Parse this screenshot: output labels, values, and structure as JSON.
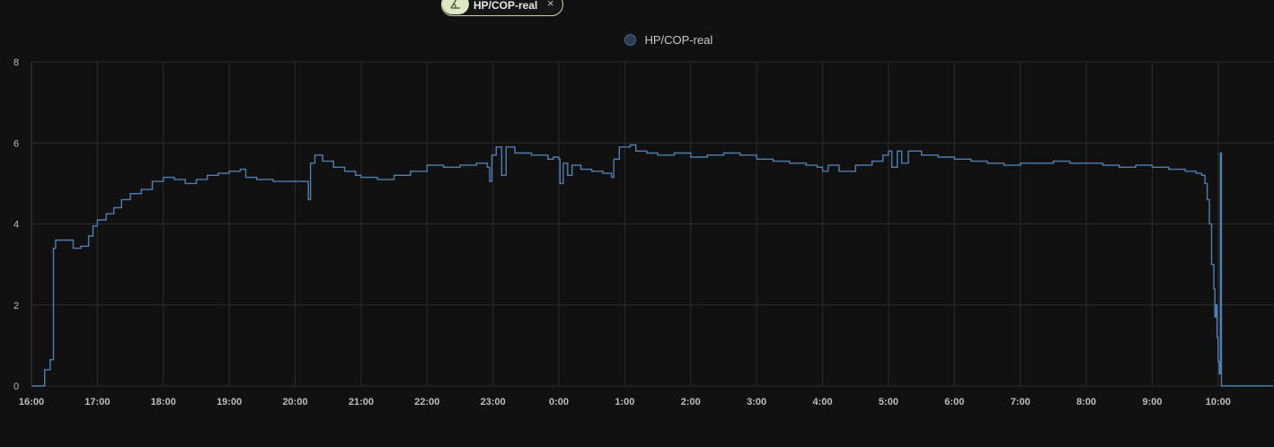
{
  "filter_chip": {
    "label": "HP/COP-real",
    "icon": "sigma-icon",
    "close_glyph": "×"
  },
  "legend": {
    "label": "HP/COP-real",
    "color": "#4a6d93"
  },
  "colors": {
    "background": "#111111",
    "grid": "#2c2c2c",
    "line": "#4f7fb0"
  },
  "chart_data": {
    "type": "line",
    "title": "",
    "xlabel": "",
    "ylabel": "",
    "ylim": [
      0,
      8
    ],
    "yticks": [
      "0",
      "2",
      "4",
      "6",
      "8"
    ],
    "xlim": [
      "16:00",
      "10:50"
    ],
    "xticks": [
      "16:00",
      "17:00",
      "18:00",
      "19:00",
      "20:00",
      "21:00",
      "22:00",
      "23:00",
      "0:00",
      "1:00",
      "2:00",
      "3:00",
      "4:00",
      "5:00",
      "6:00",
      "7:00",
      "8:00",
      "9:00",
      "10:00"
    ],
    "grid": true,
    "legend_position": "top-center",
    "series": [
      {
        "name": "HP/COP-real",
        "step": true,
        "color": "#4f7fb0",
        "points": [
          [
            "16:00",
            0
          ],
          [
            "16:12",
            0
          ],
          [
            "16:12",
            0.4
          ],
          [
            "16:17",
            0.65
          ],
          [
            "16:20",
            3.4
          ],
          [
            "16:22",
            3.6
          ],
          [
            "16:30",
            3.6
          ],
          [
            "16:38",
            3.4
          ],
          [
            "16:45",
            3.45
          ],
          [
            "16:52",
            3.7
          ],
          [
            "16:56",
            3.95
          ],
          [
            "17:00",
            4.1
          ],
          [
            "17:08",
            4.25
          ],
          [
            "17:15",
            4.4
          ],
          [
            "17:22",
            4.6
          ],
          [
            "17:30",
            4.75
          ],
          [
            "17:40",
            4.85
          ],
          [
            "17:50",
            5.05
          ],
          [
            "18:00",
            5.15
          ],
          [
            "18:10",
            5.1
          ],
          [
            "18:20",
            5.0
          ],
          [
            "18:30",
            5.1
          ],
          [
            "18:40",
            5.2
          ],
          [
            "18:50",
            5.25
          ],
          [
            "19:00",
            5.3
          ],
          [
            "19:10",
            5.35
          ],
          [
            "19:15",
            5.15
          ],
          [
            "19:25",
            5.1
          ],
          [
            "19:40",
            5.05
          ],
          [
            "20:00",
            5.05
          ],
          [
            "20:10",
            5.05
          ],
          [
            "20:12",
            4.6
          ],
          [
            "20:14",
            5.5
          ],
          [
            "20:18",
            5.7
          ],
          [
            "20:25",
            5.55
          ],
          [
            "20:35",
            5.4
          ],
          [
            "20:45",
            5.3
          ],
          [
            "20:55",
            5.2
          ],
          [
            "21:00",
            5.15
          ],
          [
            "21:15",
            5.1
          ],
          [
            "21:30",
            5.2
          ],
          [
            "21:45",
            5.3
          ],
          [
            "22:00",
            5.45
          ],
          [
            "22:15",
            5.4
          ],
          [
            "22:30",
            5.45
          ],
          [
            "22:45",
            5.5
          ],
          [
            "22:55",
            5.4
          ],
          [
            "22:57",
            5.05
          ],
          [
            "22:59",
            5.7
          ],
          [
            "23:03",
            5.9
          ],
          [
            "23:08",
            5.2
          ],
          [
            "23:12",
            5.9
          ],
          [
            "23:20",
            5.75
          ],
          [
            "23:35",
            5.7
          ],
          [
            "23:50",
            5.6
          ],
          [
            "23:55",
            5.65
          ],
          [
            "0:00",
            5.6
          ],
          [
            "0:01",
            5.0
          ],
          [
            "0:04",
            5.5
          ],
          [
            "0:08",
            5.2
          ],
          [
            "0:12",
            5.45
          ],
          [
            "0:20",
            5.35
          ],
          [
            "0:30",
            5.3
          ],
          [
            "0:40",
            5.25
          ],
          [
            "0:48",
            5.15
          ],
          [
            "0:50",
            5.6
          ],
          [
            "0:55",
            5.9
          ],
          [
            "1:05",
            5.95
          ],
          [
            "1:10",
            5.8
          ],
          [
            "1:20",
            5.75
          ],
          [
            "1:30",
            5.7
          ],
          [
            "1:45",
            5.75
          ],
          [
            "2:00",
            5.65
          ],
          [
            "2:15",
            5.7
          ],
          [
            "2:30",
            5.75
          ],
          [
            "2:45",
            5.7
          ],
          [
            "3:00",
            5.6
          ],
          [
            "3:15",
            5.55
          ],
          [
            "3:30",
            5.5
          ],
          [
            "3:45",
            5.45
          ],
          [
            "3:55",
            5.4
          ],
          [
            "4:00",
            5.3
          ],
          [
            "4:05",
            5.45
          ],
          [
            "4:15",
            5.3
          ],
          [
            "4:30",
            5.45
          ],
          [
            "4:45",
            5.55
          ],
          [
            "4:55",
            5.7
          ],
          [
            "5:00",
            5.8
          ],
          [
            "5:03",
            5.4
          ],
          [
            "5:08",
            5.8
          ],
          [
            "5:12",
            5.5
          ],
          [
            "5:18",
            5.8
          ],
          [
            "5:30",
            5.7
          ],
          [
            "5:45",
            5.65
          ],
          [
            "6:00",
            5.6
          ],
          [
            "6:15",
            5.55
          ],
          [
            "6:30",
            5.5
          ],
          [
            "6:45",
            5.45
          ],
          [
            "7:00",
            5.5
          ],
          [
            "7:15",
            5.5
          ],
          [
            "7:30",
            5.55
          ],
          [
            "7:45",
            5.5
          ],
          [
            "8:00",
            5.5
          ],
          [
            "8:15",
            5.45
          ],
          [
            "8:30",
            5.4
          ],
          [
            "8:45",
            5.45
          ],
          [
            "9:00",
            5.4
          ],
          [
            "9:15",
            5.35
          ],
          [
            "9:30",
            5.3
          ],
          [
            "9:40",
            5.25
          ],
          [
            "9:45",
            5.2
          ],
          [
            "9:48",
            5.0
          ],
          [
            "9:50",
            4.6
          ],
          [
            "9:52",
            4.0
          ],
          [
            "9:54",
            3.0
          ],
          [
            "9:56",
            2.4
          ],
          [
            "9:57",
            1.7
          ],
          [
            "9:58",
            2.0
          ],
          [
            "9:59",
            1.2
          ],
          [
            "10:00",
            0.6
          ],
          [
            "10:01",
            0.3
          ],
          [
            "10:02",
            5.75
          ],
          [
            "10:03",
            0.0
          ],
          [
            "10:50",
            0.0
          ]
        ]
      }
    ]
  }
}
